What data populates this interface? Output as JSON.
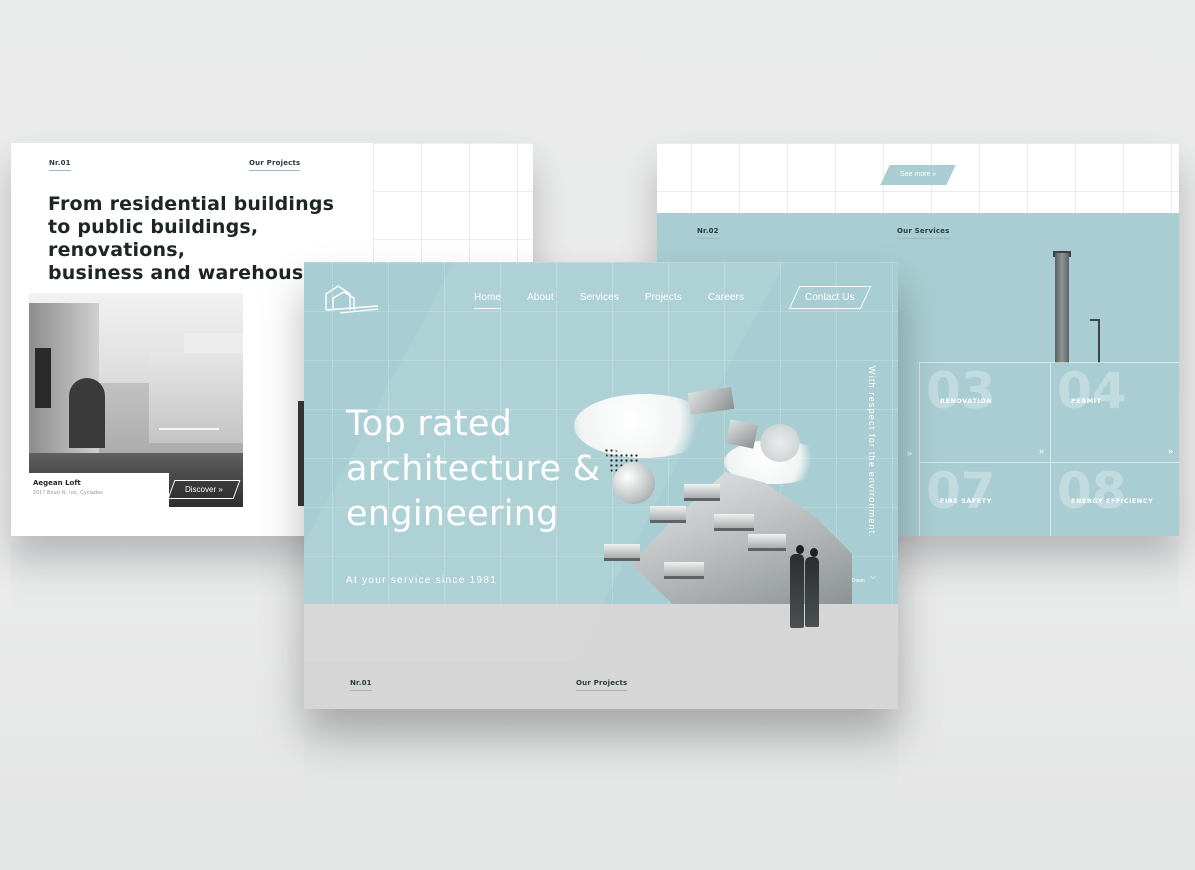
{
  "left_card": {
    "tag_number": "Nr.01",
    "tag_section": "Our Projects",
    "headline_lines": [
      "From residential buildings",
      "to public buildings, renovations,",
      "business and warehouses."
    ],
    "project_title": "Aegean Loft",
    "project_subtitle": "2017 Bouri N. Ios, Cyclades",
    "discover_label": "Discover »"
  },
  "right_card": {
    "see_more_label": "See more »",
    "tag_number": "Nr.02",
    "tag_section": "Our Services",
    "services": [
      {
        "num": "03",
        "label": "RENOVATION"
      },
      {
        "num": "04",
        "label": "PERMIT"
      },
      {
        "num": "07",
        "label": "FIRE SAFETY"
      },
      {
        "num": "08",
        "label": "ENERGY EFFICIENCY"
      }
    ],
    "arrow": "»"
  },
  "main_card": {
    "nav": [
      "Home",
      "About",
      "Services",
      "Projects",
      "Careers"
    ],
    "active_nav": "Home",
    "contact_label": "Contact Us",
    "hero_title_lines": [
      "Top rated",
      "architecture &",
      "engineering"
    ],
    "hero_subtitle": "At your service since 1981",
    "vertical_text": "With respect for the environment.",
    "scroll_label": "Scroll Down",
    "scroll_arrow": "⌵",
    "tag_number": "Nr.01",
    "tag_section": "Our Projects"
  },
  "colors": {
    "accent": "#a9cdd2",
    "text_dark": "#1e2526",
    "background": "#ebebeb"
  },
  "icons": [
    "house-logo-icon",
    "chevron-right-icon",
    "chevron-down-icon"
  ]
}
